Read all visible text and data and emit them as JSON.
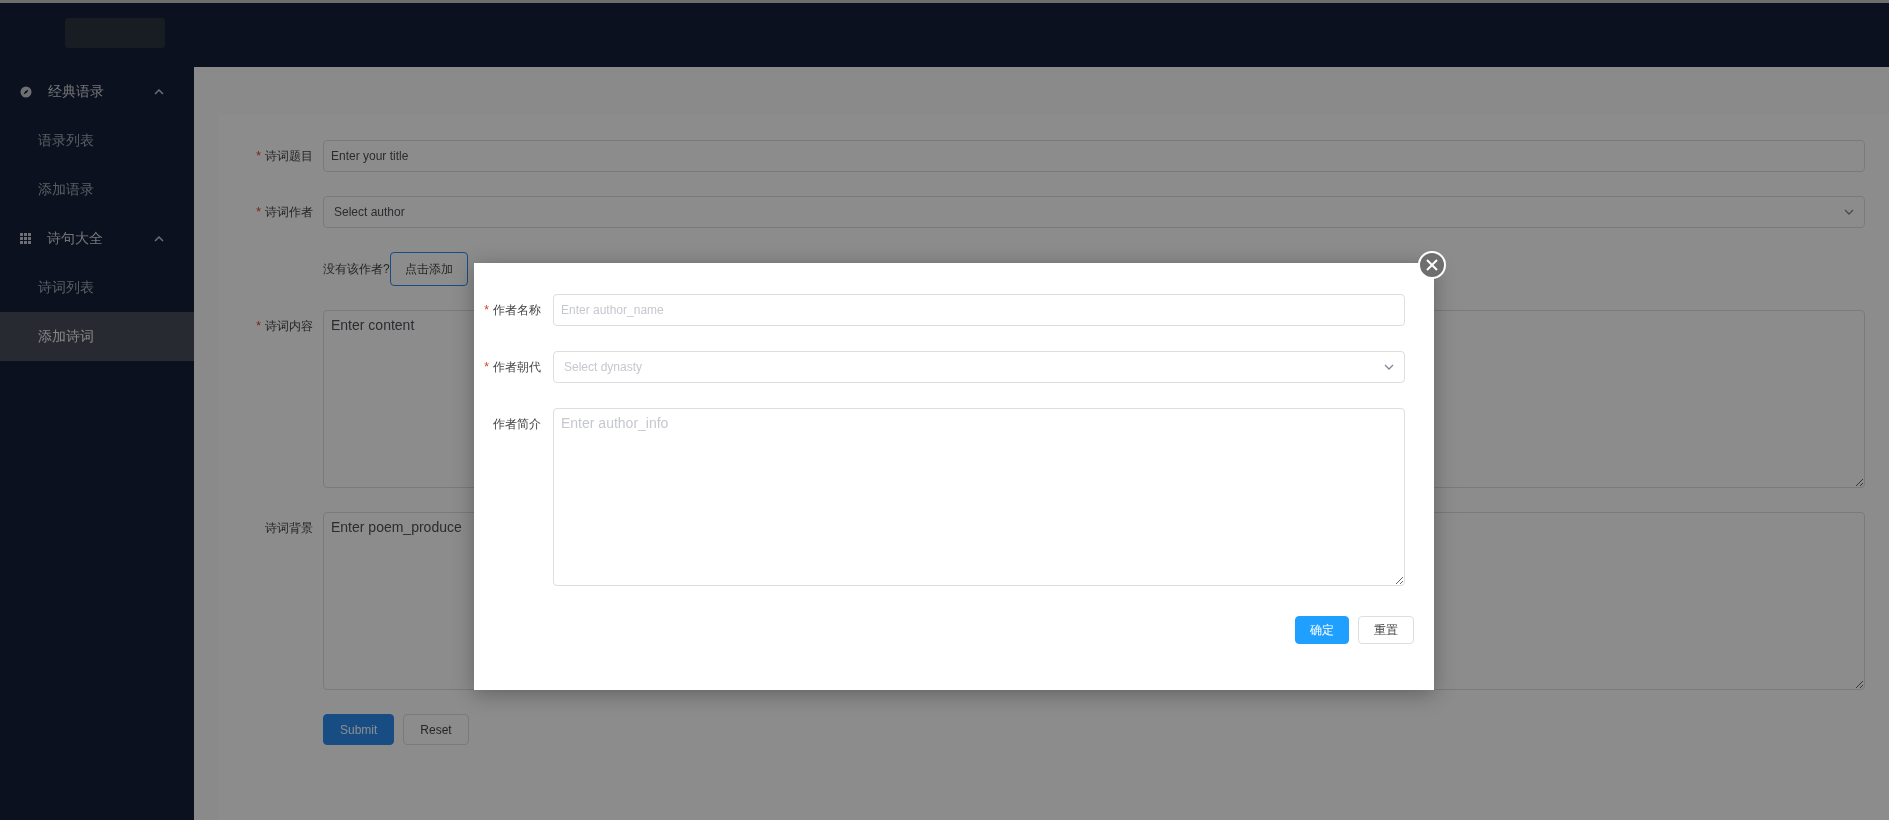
{
  "sidebar": {
    "groups": [
      {
        "label": "经典语录",
        "kind": "compass",
        "expanded": true,
        "items": [
          {
            "label": "语录列表",
            "selected": false
          },
          {
            "label": "添加语录",
            "selected": false
          }
        ]
      },
      {
        "label": "诗句大全",
        "kind": "grid",
        "expanded": true,
        "items": [
          {
            "label": "诗词列表",
            "selected": false
          },
          {
            "label": "添加诗词",
            "selected": true
          }
        ]
      }
    ]
  },
  "form": {
    "fields": [
      {
        "label": "诗词题目",
        "required_mark": "*",
        "kind": "input",
        "placeholder": "Enter your title"
      },
      {
        "label": "诗词作者",
        "required_mark": "*",
        "kind": "select",
        "placeholder": "Select author"
      },
      {
        "kind": "helper",
        "text": "没有该作者?",
        "button": "点击添加"
      },
      {
        "label": "诗词内容",
        "required_mark": "*",
        "kind": "textarea",
        "placeholder": "Enter content"
      },
      {
        "label": "诗词背景",
        "kind": "textarea",
        "placeholder": "Enter poem_produce"
      }
    ],
    "buttons": [
      {
        "label": "Submit",
        "kind": "primary"
      },
      {
        "label": "Reset",
        "kind": "default"
      }
    ]
  },
  "modal": {
    "fields": [
      {
        "label": "作者名称",
        "required_mark": "*",
        "kind": "input",
        "placeholder": "Enter author_name"
      },
      {
        "label": "作者朝代",
        "required_mark": "*",
        "kind": "select",
        "placeholder": "Select dynasty"
      },
      {
        "label": "作者简介",
        "kind": "textarea",
        "placeholder": "Enter author_info"
      }
    ],
    "buttons": [
      {
        "label": "确定",
        "kind": "primary"
      },
      {
        "label": "重置",
        "kind": "default"
      }
    ]
  }
}
